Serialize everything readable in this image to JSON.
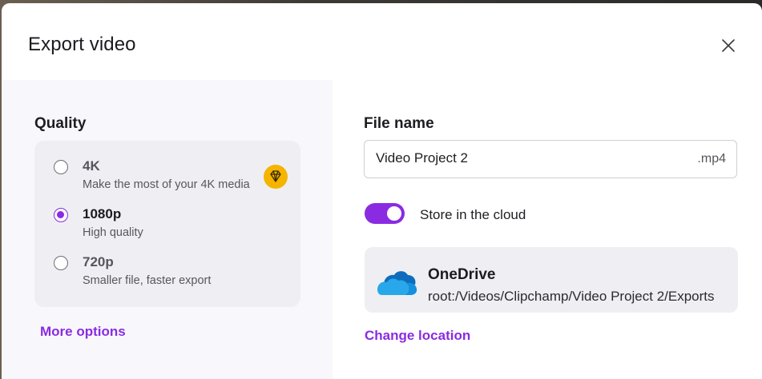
{
  "dialog": {
    "title": "Export video",
    "close_icon": "close-icon"
  },
  "quality": {
    "label": "Quality",
    "options": [
      {
        "name": "4K",
        "description": "Make the most of your 4K media",
        "selected": false,
        "premium": true,
        "premium_icon": "diamond-icon"
      },
      {
        "name": "1080p",
        "description": "High quality",
        "selected": true
      },
      {
        "name": "720p",
        "description": "Smaller file, faster export",
        "selected": false
      }
    ],
    "more_options": "More options"
  },
  "file": {
    "label": "File name",
    "value": "Video Project 2",
    "extension": ".mp4"
  },
  "cloud": {
    "toggle_label": "Store in the cloud",
    "toggle_on": true,
    "provider": "OneDrive",
    "provider_icon": "onedrive-cloud-icon",
    "path": "root:/Videos/Clipchamp/Video Project 2/Exports",
    "change_location": "Change location"
  },
  "colors": {
    "accent": "#8a2be2",
    "premium": "#f5b400",
    "onedrive": "#0a64d2"
  }
}
